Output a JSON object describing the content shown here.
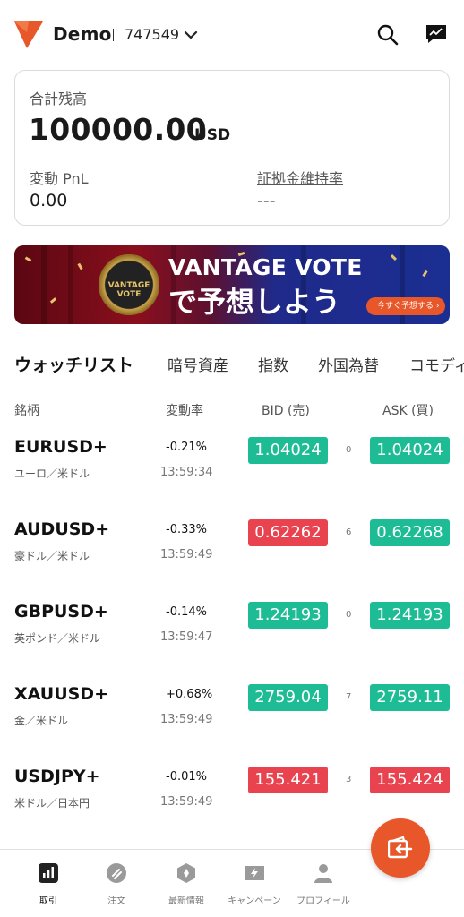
{
  "header": {
    "account_name": "Demo",
    "account_number": "747549"
  },
  "balance_card": {
    "total_label": "合計残高",
    "total_value": "100000.00",
    "currency": "USD",
    "pnl_label": "変動 PnL",
    "pnl_value": "0.00",
    "margin_label": "証拠金維持率",
    "margin_value": "---"
  },
  "banner": {
    "title_line1": "VANTAGE VOTE",
    "title_line2": "で予想しよう",
    "cta": "今すぐ予想する ›",
    "medal_text": "VANTAGE VOTE"
  },
  "tabs": [
    "ウォッチリスト",
    "暗号資産",
    "指数",
    "外国為替",
    "コモディティ"
  ],
  "columns": {
    "symbol": "銘柄",
    "change": "変動率",
    "bid": "BID (売)",
    "ask": "ASK (買)"
  },
  "rows": [
    {
      "symbol": "EURUSD+",
      "name": "ユーロ／米ドル",
      "change": "-0.21%",
      "time": "13:59:34",
      "bid": "1.04024",
      "spread": "0",
      "ask": "1.04024",
      "bid_dir": "up",
      "ask_dir": "up"
    },
    {
      "symbol": "AUDUSD+",
      "name": "豪ドル／米ドル",
      "change": "-0.33%",
      "time": "13:59:49",
      "bid": "0.62262",
      "spread": "6",
      "ask": "0.62268",
      "bid_dir": "down",
      "ask_dir": "up"
    },
    {
      "symbol": "GBPUSD+",
      "name": "英ポンド／米ドル",
      "change": "-0.14%",
      "time": "13:59:47",
      "bid": "1.24193",
      "spread": "0",
      "ask": "1.24193",
      "bid_dir": "up",
      "ask_dir": "up"
    },
    {
      "symbol": "XAUUSD+",
      "name": "金／米ドル",
      "change": "+0.68%",
      "time": "13:59:49",
      "bid": "2759.04",
      "spread": "7",
      "ask": "2759.11",
      "bid_dir": "up",
      "ask_dir": "up"
    },
    {
      "symbol": "USDJPY+",
      "name": "米ドル／日本円",
      "change": "-0.01%",
      "time": "13:59:49",
      "bid": "155.421",
      "spread": "3",
      "ask": "155.424",
      "bid_dir": "down",
      "ask_dir": "down"
    }
  ],
  "colors": {
    "up": "#1dbc94",
    "down": "#e8434f",
    "accent": "#e8572a"
  },
  "nav": [
    {
      "label": "取引",
      "icon": "chart-bars-icon",
      "active": true
    },
    {
      "label": "注文",
      "icon": "order-icon",
      "active": false
    },
    {
      "label": "最新情報",
      "icon": "news-icon",
      "active": false
    },
    {
      "label": "キャンペーン",
      "icon": "campaign-icon",
      "active": false
    },
    {
      "label": "プロフィール",
      "icon": "profile-icon",
      "active": false
    }
  ]
}
